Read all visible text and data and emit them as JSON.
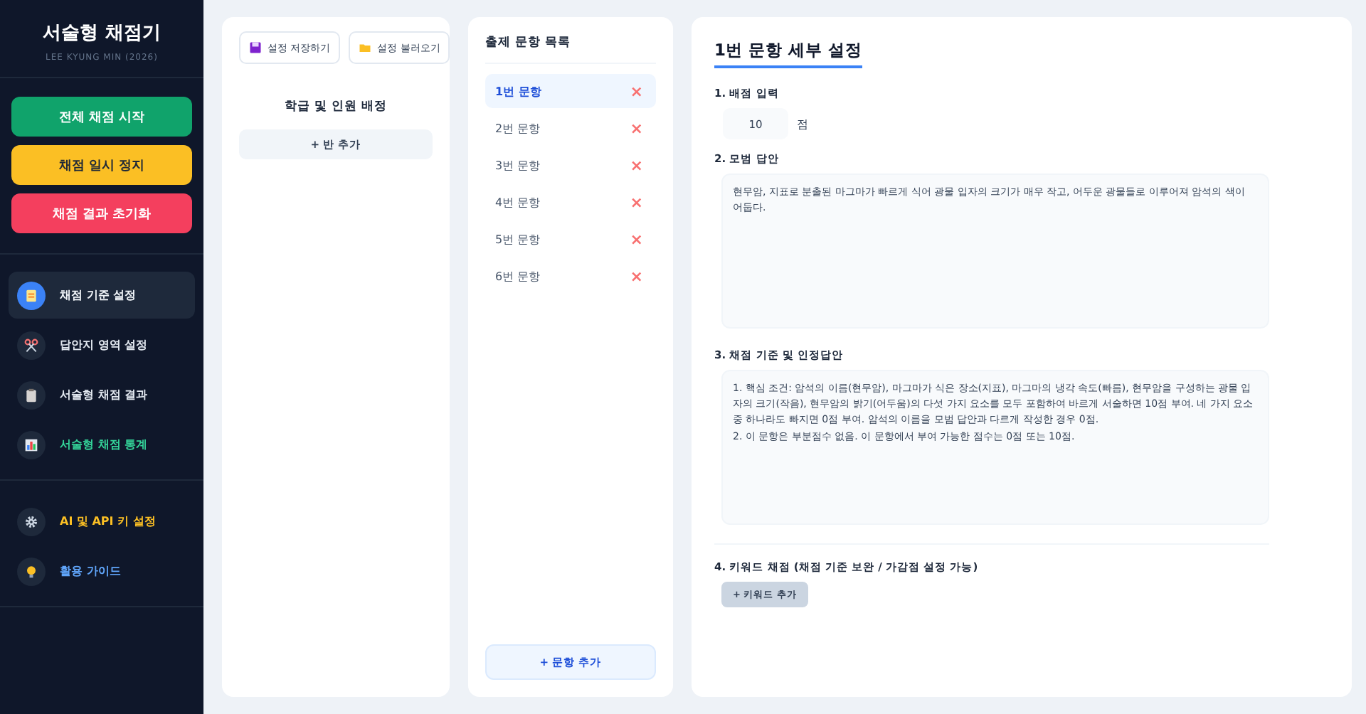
{
  "sidebar": {
    "title": "서술형 채점기",
    "subtitle": "LEE KYUNG MIN (2026)",
    "actions": [
      {
        "label": "전체 채점 시작",
        "kind": "start"
      },
      {
        "label": "채점 일시 정지",
        "kind": "pause"
      },
      {
        "label": "채점 결과 초기화",
        "kind": "reset"
      }
    ],
    "nav": [
      {
        "label": "채점 기준 설정",
        "kind": "memo",
        "selected": true,
        "color": "#f1f5f9"
      },
      {
        "label": "답안지 영역 설정",
        "kind": "scissors",
        "selected": false,
        "color": "#e2e8f0"
      },
      {
        "label": "서술형 채점 결과",
        "kind": "clipboard",
        "selected": false,
        "color": "#e2e8f0"
      },
      {
        "label": "서술형 채점 통계",
        "kind": "chart",
        "selected": false,
        "color": "#34d399"
      }
    ],
    "nav2": [
      {
        "label": "AI 및 API 키 설정",
        "kind": "gear",
        "selected": false,
        "color": "#fbbf24"
      },
      {
        "label": "활용 가이드",
        "kind": "bulb",
        "selected": false,
        "color": "#60a5fa"
      }
    ]
  },
  "class_panel": {
    "buttons": [
      {
        "label": "설정 저장하기",
        "kind": "disk"
      },
      {
        "label": "설정 불러오기",
        "kind": "folder"
      }
    ],
    "heading": "학급 및 인원 배정",
    "add_button": "+ 반 추가"
  },
  "question_list": {
    "title": "출제 문항 목록",
    "items": [
      {
        "label": "1번 문항",
        "selected": true,
        "delete": "×"
      },
      {
        "label": "2번 문항",
        "selected": false,
        "delete": "×"
      },
      {
        "label": "3번 문항",
        "selected": false,
        "delete": "×"
      },
      {
        "label": "4번 문항",
        "selected": false,
        "delete": "×"
      },
      {
        "label": "5번 문항",
        "selected": false,
        "delete": "×"
      },
      {
        "label": "6번 문항",
        "selected": false,
        "delete": "×"
      }
    ],
    "add_button": "+ 문항 추가"
  },
  "detail": {
    "title": "1번 문항 세부 설정",
    "score_label": "1. 배점 입력",
    "score_value": "10",
    "score_unit": "점",
    "model_label": "2. 모범 답안",
    "model_answer": "현무암, 지표로 분출된 마그마가 빠르게 식어 광물 입자의 크기가 매우 작고, 어두운 광물들로 이루어져 암석의 색이 어둡다.",
    "criteria_label": "3. 채점 기준 및 인정답안",
    "criteria": "1. 핵심 조건: 암석의 이름(현무암), 마그마가 식은 장소(지표), 마그마의 냉각 속도(빠름), 현무암을 구성하는 광물 입자의 크기(작음), 현무암의 밝기(어두움)의 다섯 가지 요소를 모두 포함하여 바르게 서술하면 10점 부여. 네 가지 요소 중 하나라도 빠지면 0점 부여. 암석의 이름을 모범 답안과 다르게 작성한 경우 0점.\n2. 이 문항은 부분점수 없음. 이 문항에서 부여 가능한 점수는 0점 또는 10점.",
    "keyword_label": "4. 키워드 채점 (채점 기준 보완 / 가감점 설정 가능)",
    "keyword_button": "+ 키워드 추가"
  }
}
